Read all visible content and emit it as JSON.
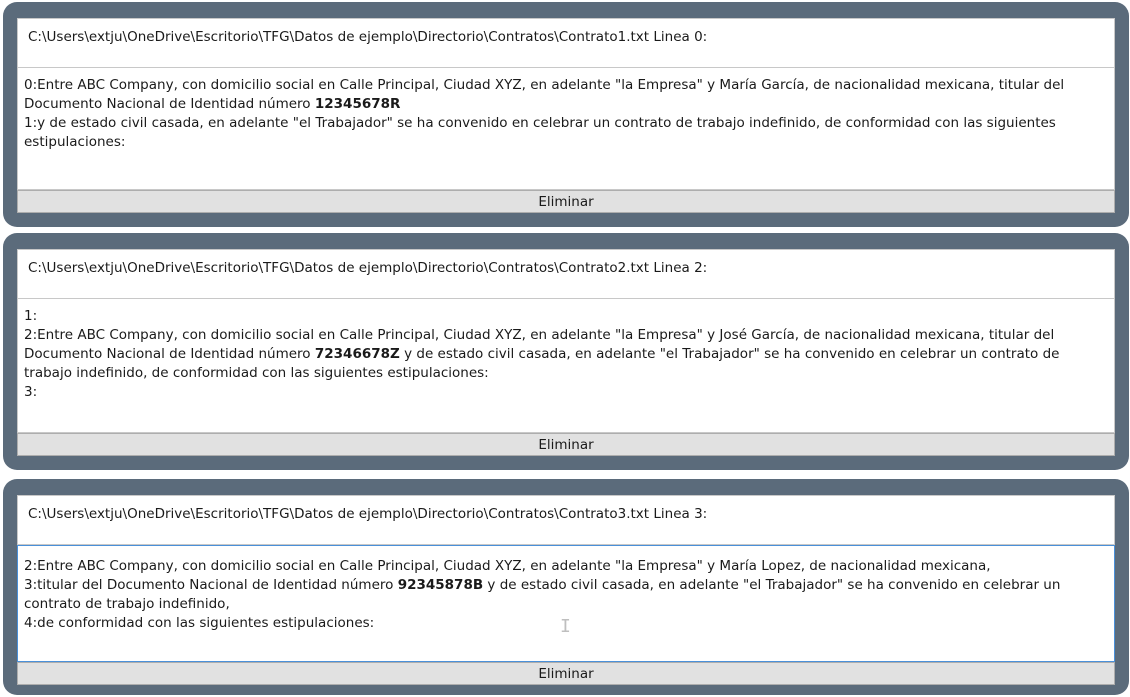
{
  "cards": [
    {
      "path": "C:\\Users\\extju\\OneDrive\\Escritorio\\TFG\\Datos de ejemplo\\Directorio\\Contratos\\Contrato1.txt Linea 0:",
      "lines": [
        {
          "pre": "0:Entre ABC Company, con domicilio social en Calle Principal, Ciudad XYZ, en adelante \"la Empresa\" y María García, de nacionalidad mexicana, titular del Documento Nacional de Identidad número ",
          "bold": "12345678R",
          "post": ""
        },
        {
          "pre": "1:y de estado civil casada, en adelante \"el Trabajador\" se ha convenido en celebrar un contrato de trabajo indefinido, de conformidad con las siguientes estipulaciones:",
          "bold": "",
          "post": ""
        }
      ],
      "delete_label": "Eliminar"
    },
    {
      "path": "C:\\Users\\extju\\OneDrive\\Escritorio\\TFG\\Datos de ejemplo\\Directorio\\Contratos\\Contrato2.txt Linea 2:",
      "lines": [
        {
          "pre": "1:",
          "bold": "",
          "post": ""
        },
        {
          "pre": "2:Entre ABC Company, con domicilio social en Calle Principal, Ciudad XYZ, en adelante \"la Empresa\" y José García, de nacionalidad mexicana, titular del Documento Nacional de Identidad número ",
          "bold": "72346678Z",
          "post": " y de estado civil casada, en adelante \"el Trabajador\" se ha convenido en celebrar un contrato de trabajo indefinido, de conformidad con las siguientes estipulaciones:"
        },
        {
          "pre": "3:",
          "bold": "",
          "post": ""
        }
      ],
      "delete_label": "Eliminar"
    },
    {
      "path": "C:\\Users\\extju\\OneDrive\\Escritorio\\TFG\\Datos de ejemplo\\Directorio\\Contratos\\Contrato3.txt Linea 3:",
      "lines": [
        {
          "pre": "2:Entre ABC Company, con domicilio social en Calle Principal, Ciudad XYZ, en adelante \"la Empresa\" y María Lopez, de nacionalidad mexicana,",
          "bold": "",
          "post": ""
        },
        {
          "pre": "3:titular del Documento Nacional de Identidad número ",
          "bold": "92345878B",
          "post": " y de estado civil casada, en adelante \"el Trabajador\" se ha convenido en celebrar un contrato de trabajo indefinido,"
        },
        {
          "pre": "4:de conformidad con las siguientes estipulaciones:",
          "bold": "",
          "post": ""
        }
      ],
      "delete_label": "Eliminar"
    }
  ]
}
